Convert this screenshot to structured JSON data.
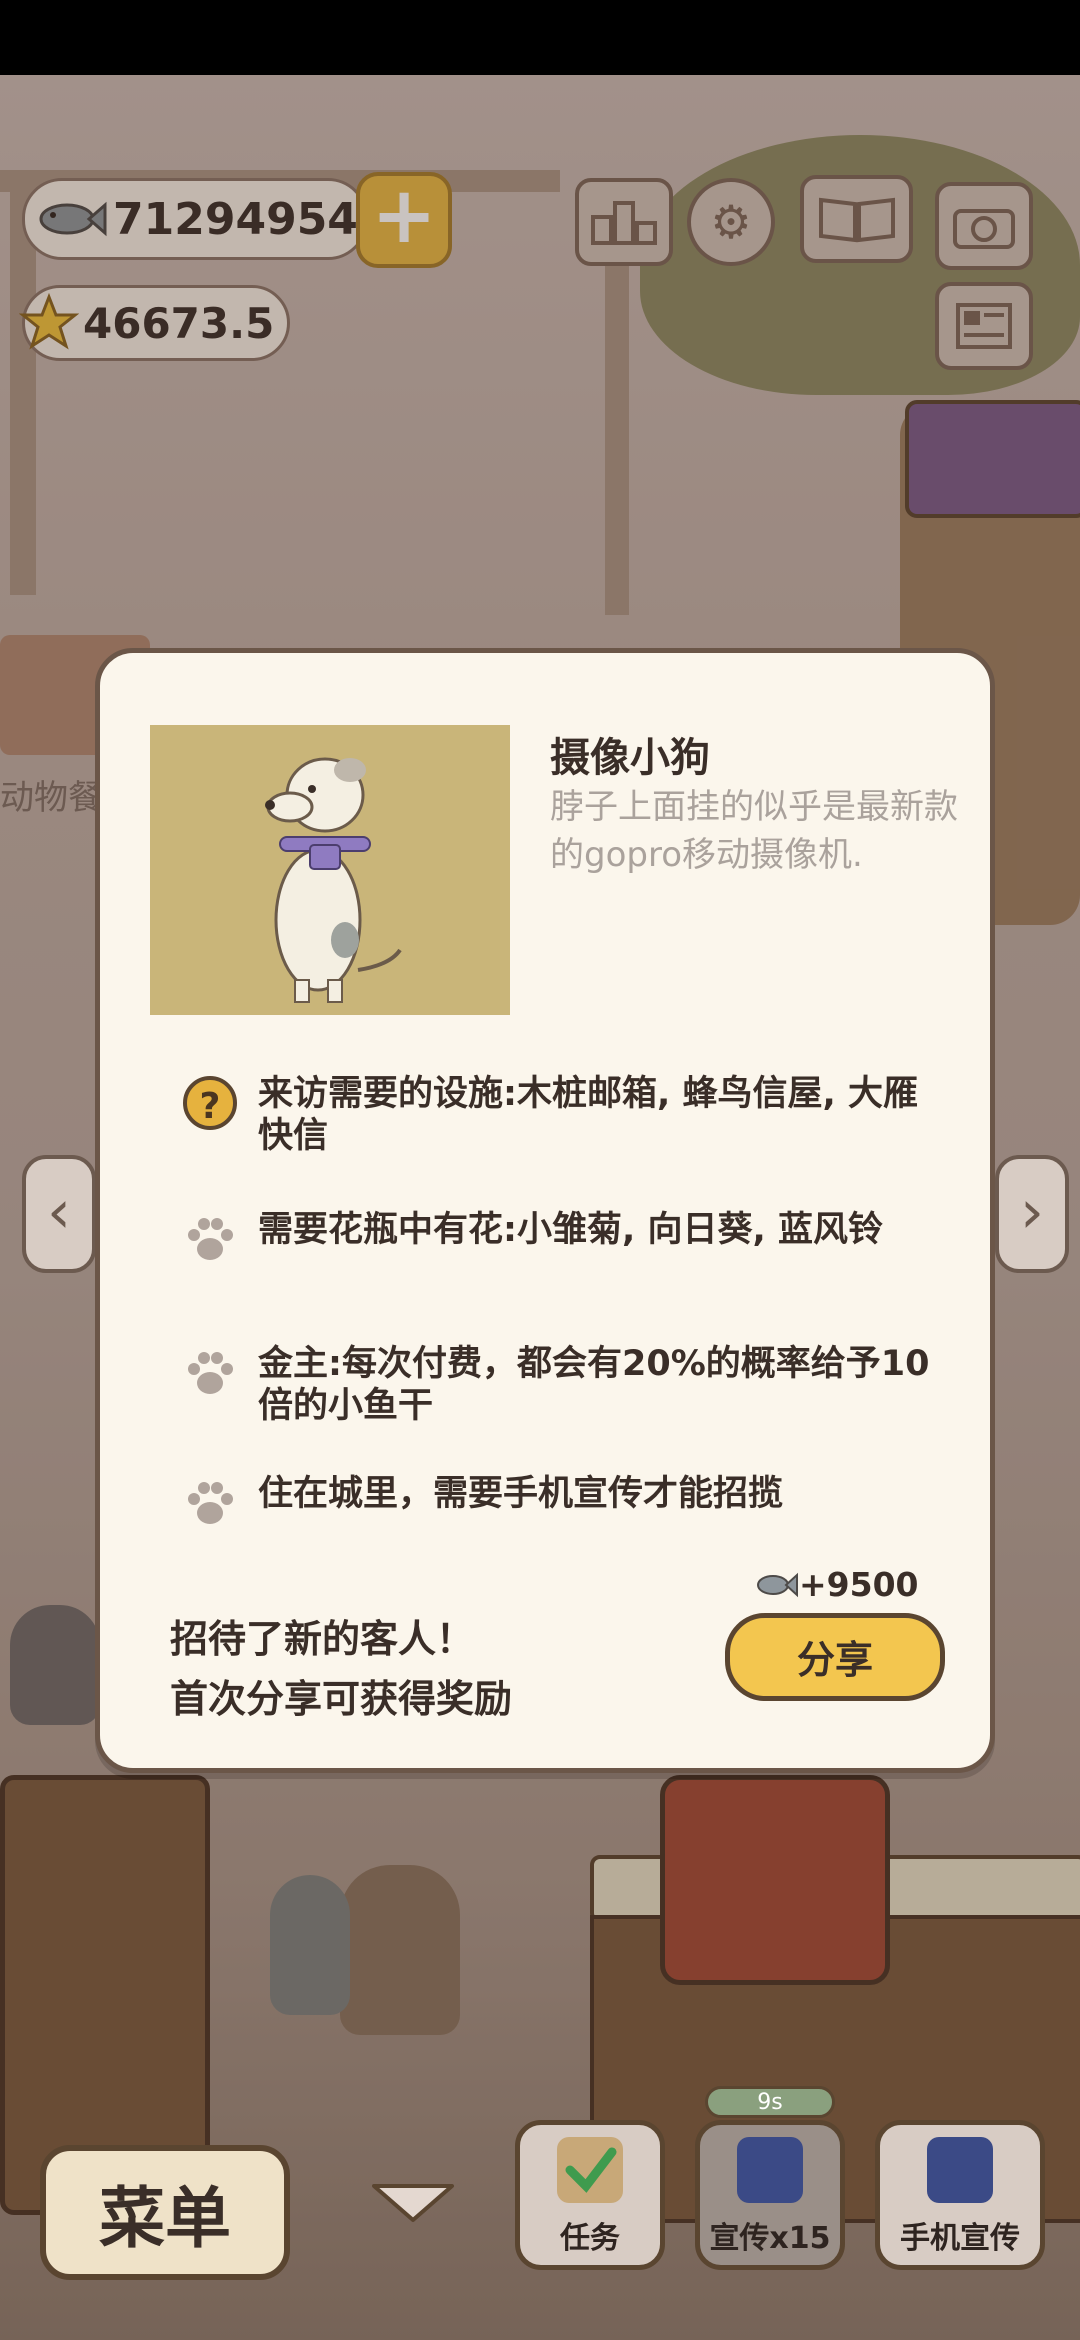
{
  "currency": {
    "fish_amount": "71294954",
    "star_amount": "46673.5",
    "plus_label": "+"
  },
  "background": {
    "partial_sign_text": "动物餐"
  },
  "dialog": {
    "character_name": "摄像小狗",
    "description": "脖子上面挂的似乎是最新款的gopro移动摄像机.",
    "requirements": [
      {
        "icon": "question-icon",
        "text": "来访需要的设施:木桩邮箱, 蜂鸟信屋, 大雁快信"
      },
      {
        "icon": "paw-icon",
        "text": "需要花瓶中有花:小雏菊, 向日葵, 蓝风铃"
      },
      {
        "icon": "paw-icon",
        "text": "金主:每次付费，都会有20%的概率给予10倍的小鱼干"
      },
      {
        "icon": "paw-icon",
        "text": "住在城里，需要手机宣传才能招揽"
      }
    ],
    "reward_label": "+9500",
    "new_guest_line1": "招待了新的客人！",
    "new_guest_line2": "首次分享可获得奖励",
    "share_label": "分享"
  },
  "bottom_bar": {
    "menu_label": "菜单",
    "task_label": "任务",
    "promo_label": "宣传x15",
    "phone_promo_label": "手机宣传",
    "timer_label": "9s"
  },
  "colors": {
    "accent_yellow": "#f3c64f",
    "dialog_bg": "#fbf6ec",
    "border_brown": "#5a4530",
    "portrait_bg": "#c9b579"
  }
}
